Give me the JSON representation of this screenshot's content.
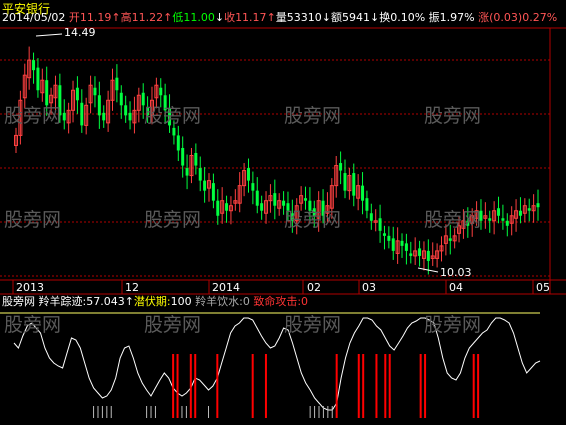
{
  "title": "平安银行",
  "info_bar": [
    {
      "text": "2014/05/02",
      "color": "#ffffff"
    },
    {
      "text": " 开",
      "color": "#ff5555"
    },
    {
      "text": "11.19",
      "color": "#ff5555"
    },
    {
      "text": "↑",
      "color": "#ff5555"
    },
    {
      "text": "高",
      "color": "#ff5555"
    },
    {
      "text": "11.22",
      "color": "#ff5555"
    },
    {
      "text": "↑",
      "color": "#ff5555"
    },
    {
      "text": "低",
      "color": "#00ff00"
    },
    {
      "text": "11.00",
      "color": "#00ff00"
    },
    {
      "text": "↓",
      "color": "#ffffff"
    },
    {
      "text": "收",
      "color": "#ff5555"
    },
    {
      "text": "11.17",
      "color": "#ff5555"
    },
    {
      "text": "↑",
      "color": "#ff5555"
    },
    {
      "text": "量",
      "color": "#ffffff"
    },
    {
      "text": "53310",
      "color": "#ffffff"
    },
    {
      "text": "↓",
      "color": "#ffffff"
    },
    {
      "text": "额",
      "color": "#ffffff"
    },
    {
      "text": "5941",
      "color": "#ffffff"
    },
    {
      "text": "↓",
      "color": "#ffffff"
    },
    {
      "text": "换",
      "color": "#ffffff"
    },
    {
      "text": "0.10%",
      "color": "#ffffff"
    },
    {
      "text": " 振",
      "color": "#ffffff"
    },
    {
      "text": "1.97%",
      "color": "#ffffff"
    },
    {
      "text": " 涨",
      "color": "#ff5555"
    },
    {
      "text": "(0.03)",
      "color": "#ff5555"
    },
    {
      "text": "0.27%",
      "color": "#ff5555"
    }
  ],
  "indicator_bar": [
    {
      "text": "股旁网",
      "color": "#ffffff"
    },
    {
      "text": " 羚羊踪迹:",
      "color": "#ffffff"
    },
    {
      "text": "57.043",
      "color": "#ffffff"
    },
    {
      "text": "↑",
      "color": "#ffffff"
    },
    {
      "text": "潜伏期:",
      "color": "#ffff00"
    },
    {
      "text": "100",
      "color": "#ffffff"
    },
    {
      "text": " 羚羊饮水:",
      "color": "#aaaaaa"
    },
    {
      "text": "0",
      "color": "#aaaaaa"
    },
    {
      "text": " 致命攻击:",
      "color": "#ff3333"
    },
    {
      "text": "0",
      "color": "#ff3333"
    }
  ],
  "watermark": "股旁网",
  "chart_data": {
    "type": "candlestick",
    "high_label": "14.49",
    "low_label": "10.03",
    "x_ticks": [
      "2013",
      "12",
      "2014",
      "02",
      "03",
      "04",
      "05"
    ],
    "colors": {
      "up": "#ff4040",
      "down": "#00ff40",
      "grid": "#b00000",
      "line": "#ffffff",
      "spike": "#ff0000"
    },
    "price_range": [
      9.8,
      14.7
    ],
    "closes": [
      12.6,
      13.3,
      13.8,
      14.1,
      13.9,
      13.5,
      13.7,
      13.2,
      13.4,
      13.6,
      13.0,
      12.9,
      13.1,
      13.5,
      13.3,
      12.8,
      13.2,
      13.6,
      13.4,
      13.0,
      12.9,
      13.3,
      13.7,
      13.5,
      13.2,
      13.0,
      12.9,
      13.1,
      13.4,
      13.2,
      13.0,
      13.3,
      13.6,
      13.4,
      13.1,
      12.8,
      12.6,
      12.3,
      12.0,
      11.8,
      12.2,
      12.0,
      11.7,
      11.5,
      11.7,
      11.3,
      11.0,
      11.3,
      11.1,
      11.2,
      11.3,
      11.6,
      11.9,
      11.7,
      11.5,
      11.2,
      11.1,
      11.3,
      11.4,
      11.2,
      11.3,
      11.2,
      11.1,
      10.9,
      11.2,
      11.4,
      11.3,
      11.1,
      11.0,
      11.3,
      11.0,
      11.2,
      11.6,
      12.0,
      11.9,
      11.5,
      11.8,
      11.4,
      11.6,
      11.3,
      11.1,
      10.9,
      10.9,
      10.7,
      10.6,
      10.5,
      10.3,
      10.5,
      10.4,
      10.3,
      10.2,
      10.3,
      10.2,
      10.3,
      10.1,
      10.2,
      10.3,
      10.4,
      10.6,
      10.5,
      10.6,
      10.8,
      10.9,
      10.8,
      11.0,
      11.1,
      10.9,
      11.0,
      10.9,
      11.1,
      11.0,
      10.9,
      10.8,
      11.0,
      11.1,
      11.0,
      11.2,
      11.1,
      11.2,
      11.17
    ],
    "indicator": [
      75,
      70,
      82,
      92,
      95,
      90,
      85,
      70,
      60,
      55,
      52,
      50,
      65,
      80,
      78,
      70,
      55,
      40,
      30,
      25,
      20,
      22,
      28,
      40,
      60,
      70,
      72,
      60,
      45,
      35,
      28,
      22,
      30,
      38,
      45,
      40,
      30,
      25,
      22,
      25,
      30,
      40,
      38,
      33,
      28,
      32,
      40,
      55,
      70,
      85,
      92,
      95,
      100,
      100,
      98,
      90,
      82,
      75,
      70,
      72,
      80,
      90,
      88,
      75,
      60,
      45,
      35,
      28,
      20,
      15,
      10,
      8,
      8,
      15,
      40,
      60,
      75,
      85,
      92,
      100,
      100,
      98,
      92,
      88,
      80,
      72,
      68,
      75,
      82,
      90,
      95,
      97,
      100,
      100,
      98,
      95,
      80,
      60,
      45,
      40,
      38,
      45,
      60,
      70,
      75,
      80,
      85,
      88,
      95,
      100,
      100,
      98,
      95,
      85,
      70,
      55,
      45,
      50,
      55,
      57
    ],
    "spike_positions": [
      36,
      37,
      40,
      41,
      46,
      54,
      57,
      73,
      78,
      79,
      82,
      84,
      85,
      92,
      93,
      104,
      105
    ]
  }
}
